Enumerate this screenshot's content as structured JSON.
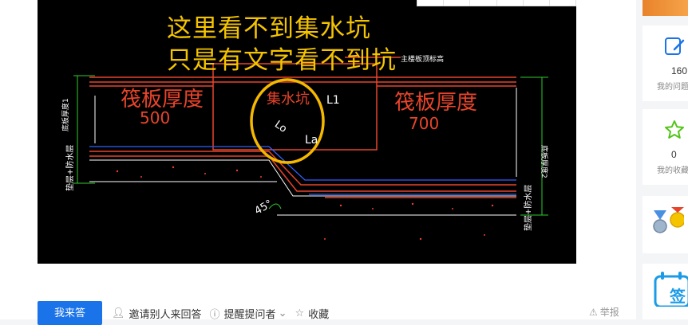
{
  "image": {
    "caption_line1": "这里看不到集水坑",
    "caption_line2": "只是有文字看不到坑",
    "cad_labels": {
      "raft_left": "筏板厚度",
      "raft_left_value": "500",
      "raft_right": "筏板厚度",
      "raft_right_value": "700",
      "pit": "集水坑",
      "l1": "L1",
      "la": "La",
      "lo": "Lo",
      "angle": "45°",
      "top_note": "主楼板顶标高",
      "left_dim": "底板厚度1",
      "right_dim": "底板厚度2",
      "left_layer": "垫层+防水层",
      "right_layer": "垫层+防水层"
    }
  },
  "actions": {
    "answer": "我来答",
    "invite": "邀请别人来回答",
    "remind": "提醒提问者",
    "collect": "收藏",
    "report": "举报"
  },
  "sidebar": {
    "my_questions_count": "160",
    "my_questions_label": "我的问题",
    "my_collection_count": "0",
    "my_collection_label": "我的收藏",
    "checkin_label": "签"
  },
  "colors": {
    "primary": "#1a73e8",
    "caption": "#f5c400",
    "cad_red": "#e8442a",
    "cad_green": "#2ecc2e"
  }
}
